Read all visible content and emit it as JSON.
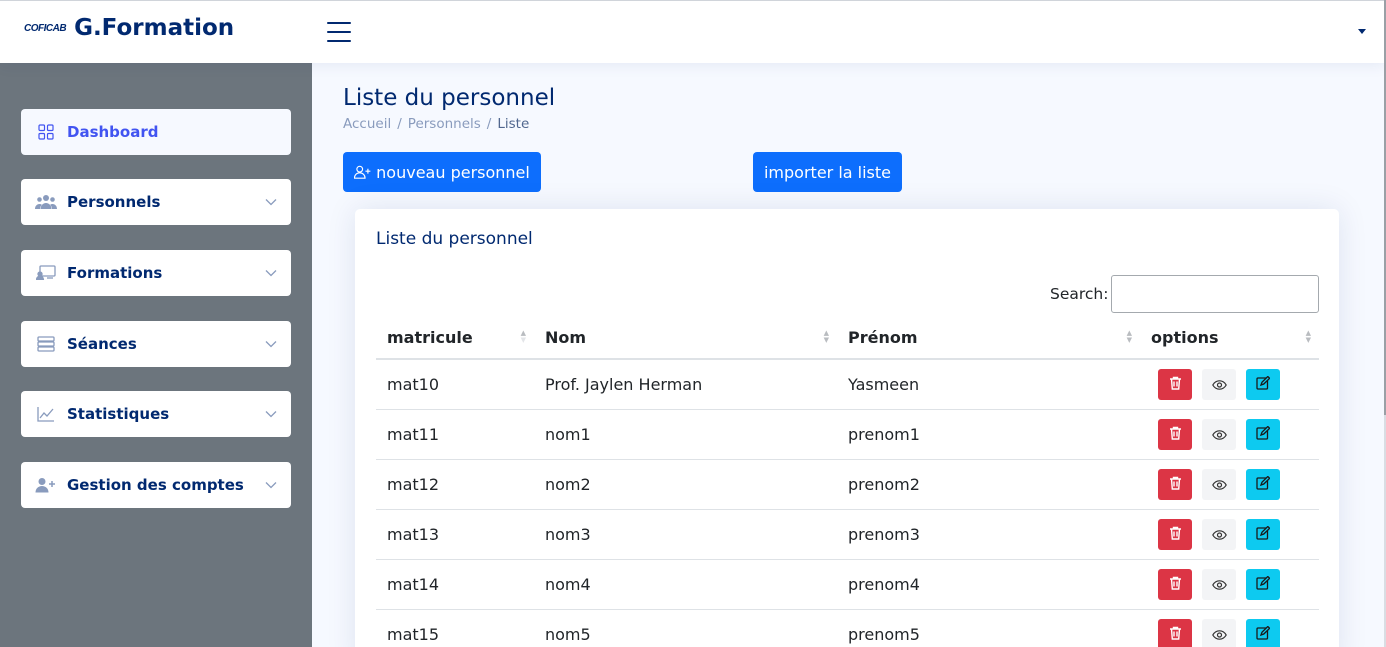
{
  "app": {
    "logo_mark": "COFICAB",
    "title": "G.Formation"
  },
  "sidebar": {
    "items": [
      {
        "label": "Dashboard",
        "icon": "grid-icon"
      },
      {
        "label": "Personnels",
        "icon": "people-icon"
      },
      {
        "label": "Formations",
        "icon": "presentation-icon"
      },
      {
        "label": "Séances",
        "icon": "server-icon"
      },
      {
        "label": "Statistiques",
        "icon": "chart-line-icon"
      },
      {
        "label": "Gestion des comptes",
        "icon": "person-plus-icon"
      }
    ]
  },
  "page": {
    "title": "Liste du personnel",
    "breadcrumb": [
      "Accueil",
      "Personnels",
      "Liste"
    ],
    "new_button": "nouveau personnel",
    "import_button": "importer la liste"
  },
  "card": {
    "title": "Liste du personnel",
    "search_label": "Search:",
    "search_value": "",
    "columns": [
      "matricule",
      "Nom",
      "Prénom",
      "options"
    ],
    "rows": [
      {
        "matricule": "mat10",
        "nom": "Prof. Jaylen Herman",
        "prenom": "Yasmeen"
      },
      {
        "matricule": "mat11",
        "nom": "nom1",
        "prenom": "prenom1"
      },
      {
        "matricule": "mat12",
        "nom": "nom2",
        "prenom": "prenom2"
      },
      {
        "matricule": "mat13",
        "nom": "nom3",
        "prenom": "prenom3"
      },
      {
        "matricule": "mat14",
        "nom": "nom4",
        "prenom": "prenom4"
      },
      {
        "matricule": "mat15",
        "nom": "nom5",
        "prenom": "prenom5"
      }
    ]
  },
  "colors": {
    "primary": "#0d6efd",
    "danger": "#dc3545",
    "info": "#0dcaf0",
    "sidebar_bg": "#6c757d",
    "navy": "#012970"
  }
}
